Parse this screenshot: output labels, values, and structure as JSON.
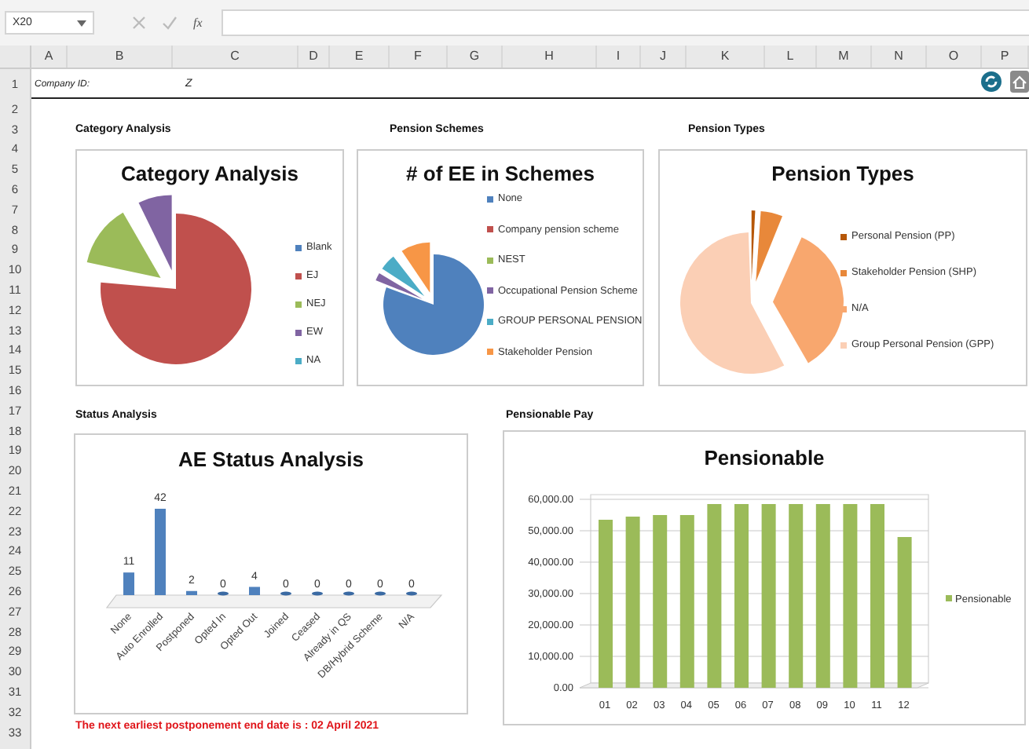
{
  "formula_bar": {
    "name_box": "X20",
    "fx": "fx"
  },
  "columns": [
    "A",
    "B",
    "C",
    "D",
    "E",
    "F",
    "G",
    "H",
    "I",
    "J",
    "K",
    "L",
    "M",
    "N",
    "O",
    "P"
  ],
  "rows": [
    "1",
    "2",
    "3",
    "4",
    "5",
    "6",
    "7",
    "8",
    "9",
    "10",
    "11",
    "12",
    "13",
    "14",
    "15",
    "16",
    "17",
    "18",
    "19",
    "20",
    "21",
    "22",
    "23",
    "24",
    "25",
    "26",
    "27",
    "28",
    "29",
    "30",
    "31",
    "32",
    "33"
  ],
  "company": {
    "label": "Company ID:",
    "value": "Z"
  },
  "pies": [
    {
      "heading": "Category Analysis",
      "title": "Category Analysis",
      "legend": [
        {
          "label": "Blank",
          "color": "#4f81bd"
        },
        {
          "label": "EJ",
          "color": "#c0504d"
        },
        {
          "label": "NEJ",
          "color": "#9bbb59"
        },
        {
          "label": "EW",
          "color": "#8064a2"
        },
        {
          "label": "NA",
          "color": "#4bacc6"
        }
      ]
    },
    {
      "heading": "Pension Schemes",
      "title": "# of EE in Schemes",
      "legend": [
        {
          "label": "None",
          "color": "#4f81bd"
        },
        {
          "label": "Company pension scheme",
          "color": "#c0504d"
        },
        {
          "label": "NEST",
          "color": "#9bbb59"
        },
        {
          "label": "Occupational Pension Scheme",
          "color": "#8064a2"
        },
        {
          "label": "GROUP PERSONAL PENSION",
          "color": "#4bacc6"
        },
        {
          "label": "Stakeholder Pension",
          "color": "#f79646"
        }
      ]
    },
    {
      "heading": "Pension Types",
      "title": "Pension Types",
      "legend": [
        {
          "label": "Personal Pension (PP)",
          "color": "#b65708"
        },
        {
          "label": "Stakeholder Pension (SHP)",
          "color": "#e8883a"
        },
        {
          "label": "N/A",
          "color": "#f8a76e"
        },
        {
          "label": "Group Personal Pension (GPP)",
          "color": "#fbcfb5"
        }
      ]
    }
  ],
  "status": {
    "heading": "Status Analysis",
    "chart_data": {
      "type": "bar",
      "title": "AE Status Analysis",
      "categories": [
        "None",
        "Auto Enrolled",
        "Postponed",
        "Opted In",
        "Opted Out",
        "Joined",
        "Ceased",
        "Already in QS",
        "DB/Hybrid Scheme",
        "N/A"
      ],
      "values": [
        11,
        42,
        2,
        0,
        4,
        0,
        0,
        0,
        0,
        0
      ],
      "data_labels": true
    }
  },
  "pay": {
    "heading": "Pensionable Pay",
    "chart_data": {
      "type": "bar",
      "title": "Pensionable",
      "categories": [
        "01",
        "02",
        "03",
        "04",
        "05",
        "06",
        "07",
        "08",
        "09",
        "10",
        "11",
        "12"
      ],
      "series": [
        {
          "name": "Pensionable",
          "color": "#9bbb59",
          "values": [
            53500,
            54500,
            55000,
            55000,
            58500,
            58500,
            58500,
            58500,
            58500,
            58500,
            58500,
            48000
          ]
        }
      ],
      "grid": true,
      "ylim": [
        0,
        60000
      ],
      "yticks": [
        {
          "value": 0,
          "label": "0.00"
        },
        {
          "value": 10000,
          "label": "10,000.00"
        },
        {
          "value": 20000,
          "label": "20,000.00"
        },
        {
          "value": 30000,
          "label": "30,000.00"
        },
        {
          "value": 40000,
          "label": "40,000.00"
        },
        {
          "value": 50000,
          "label": "50,000.00"
        },
        {
          "value": 60000,
          "label": "60,000.00"
        }
      ]
    }
  },
  "note": "The next earliest postponement end date is : 02 April 2021"
}
